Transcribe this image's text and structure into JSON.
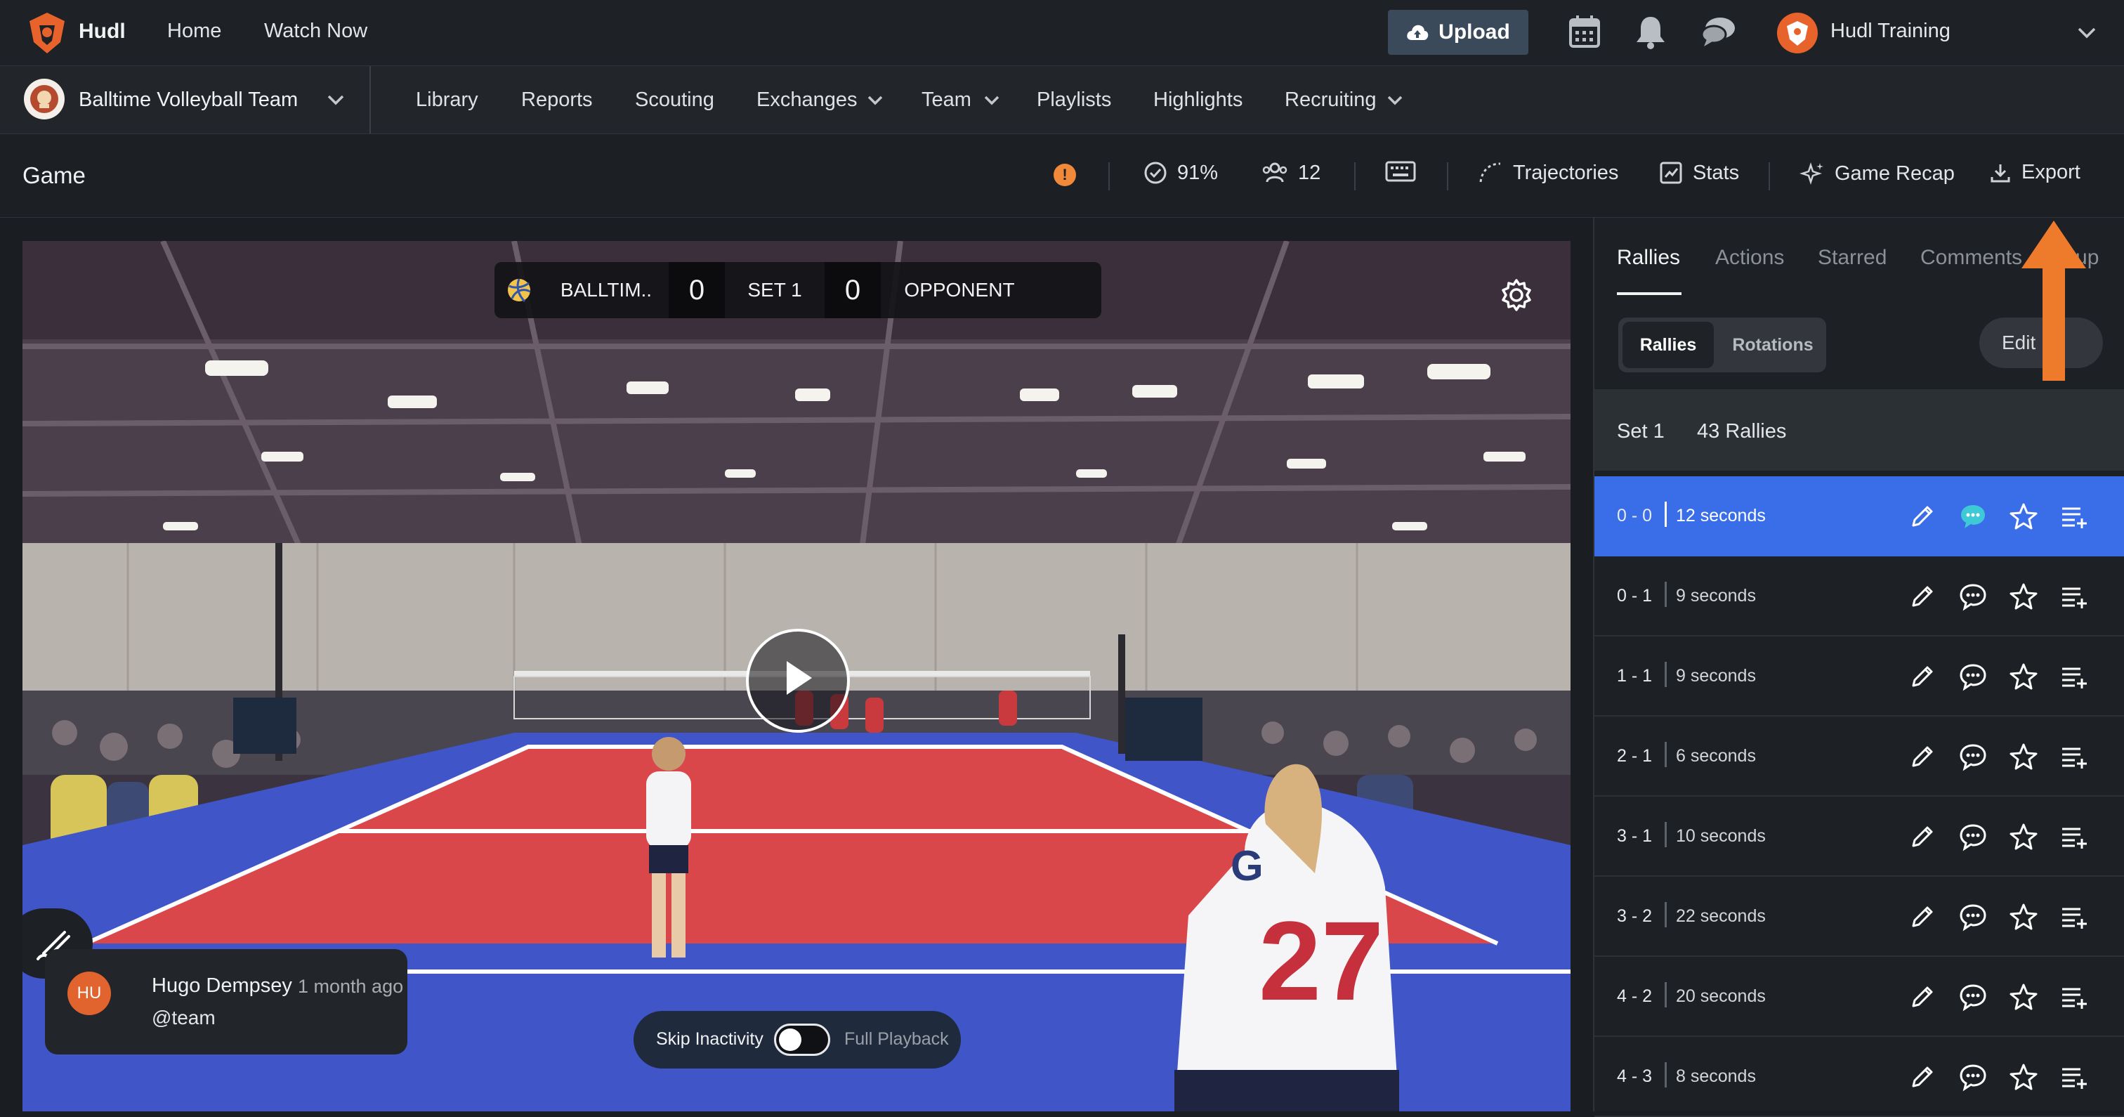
{
  "topnav": {
    "brand": "Hudl",
    "links": [
      "Home",
      "Watch Now"
    ],
    "upload_label": "Upload",
    "icons": [
      "calendar-icon",
      "bell-icon",
      "chat-icon"
    ],
    "user_name": "Hudl Training"
  },
  "teamnav": {
    "team_name": "Balltime Volleyball Team",
    "links": [
      "Library",
      "Reports",
      "Scouting",
      "Exchanges",
      "Team",
      "Playlists",
      "Highlights",
      "Recruiting"
    ]
  },
  "gamebar": {
    "title": "Game",
    "warning_glyph": "!",
    "accuracy": "91%",
    "players": "12",
    "trajectories": "Trajectories",
    "stats": "Stats",
    "game_recap": "Game Recap",
    "export": "Export"
  },
  "video": {
    "scoreboard": {
      "team": "BALLTIM..",
      "team_score": "0",
      "set": "SET 1",
      "opponent_score": "0",
      "opponent": "OPPONENT"
    },
    "comment": {
      "initials": "HU",
      "author": "Hugo Dempsey",
      "time": "1 month ago",
      "text": "@team"
    },
    "playback": {
      "skip_label": "Skip Inactivity",
      "full_label": "Full Playback",
      "skip_enabled": false
    }
  },
  "panel": {
    "tabs": [
      "Rallies",
      "Actions",
      "Starred",
      "Comments",
      "etup"
    ],
    "segment": {
      "active": "Rallies",
      "inactive": "Rotations"
    },
    "edit_label": "Edit",
    "set_label": "Set 1",
    "rally_count": "43 Rallies",
    "rallies": [
      {
        "score": "0 - 0",
        "duration": "12 seconds",
        "selected": true,
        "commented": true
      },
      {
        "score": "0 - 1",
        "duration": "9 seconds",
        "selected": false,
        "commented": false
      },
      {
        "score": "1 - 1",
        "duration": "9 seconds",
        "selected": false,
        "commented": false
      },
      {
        "score": "2 - 1",
        "duration": "6 seconds",
        "selected": false,
        "commented": false
      },
      {
        "score": "3 - 1",
        "duration": "10 seconds",
        "selected": false,
        "commented": false
      },
      {
        "score": "3 - 2",
        "duration": "22 seconds",
        "selected": false,
        "commented": false
      },
      {
        "score": "4 - 2",
        "duration": "20 seconds",
        "selected": false,
        "commented": false
      },
      {
        "score": "4 - 3",
        "duration": "8 seconds",
        "selected": false,
        "commented": false
      }
    ]
  },
  "colors": {
    "accent": "#3a6ee8",
    "brand_orange": "#e8632b",
    "callout_arrow": "#ee7a2c",
    "court_red": "#d9474a",
    "court_blue": "#3f55c8"
  }
}
